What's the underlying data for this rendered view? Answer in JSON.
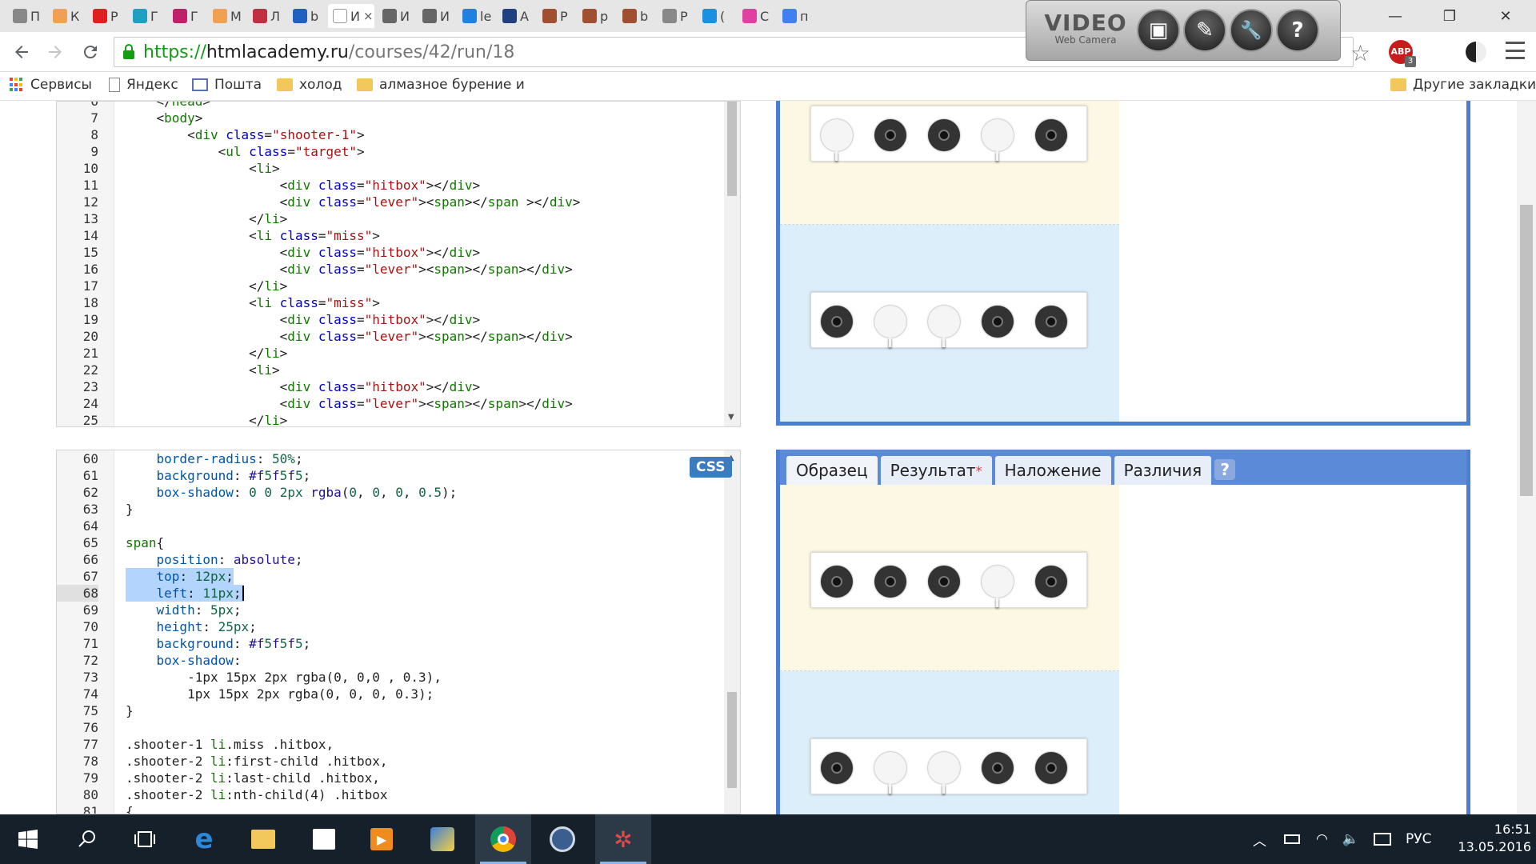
{
  "browser": {
    "tabs": [
      {
        "label": "П",
        "color": "#888888"
      },
      {
        "label": "К",
        "color": "#f0a050"
      },
      {
        "label": "Р",
        "color": "#e02020"
      },
      {
        "label": "Г",
        "color": "#20a0c0"
      },
      {
        "label": "Г",
        "color": "#c0206a"
      },
      {
        "label": "М",
        "color": "#f0a050"
      },
      {
        "label": "Л",
        "color": "#c03040"
      },
      {
        "label": "b",
        "color": "#2060c0"
      },
      {
        "label": "И",
        "color": "#ffffff",
        "active": true,
        "close": "×"
      },
      {
        "label": "И",
        "color": "#666666"
      },
      {
        "label": "И",
        "color": "#666666"
      },
      {
        "label": "le",
        "color": "#2080e0"
      },
      {
        "label": "А",
        "color": "#204080"
      },
      {
        "label": "Р",
        "color": "#a05030"
      },
      {
        "label": "р",
        "color": "#a05030"
      },
      {
        "label": "b",
        "color": "#a05030"
      },
      {
        "label": "Р",
        "color": "#888888"
      },
      {
        "label": "(",
        "color": "#1a90e0"
      },
      {
        "label": "С",
        "color": "#e040a0"
      },
      {
        "label": "п",
        "color": "#4080f0"
      }
    ],
    "url": {
      "scheme": "https://",
      "host": "htmlacademy.ru",
      "path": "/courses/42/run/18"
    },
    "bookmarks": [
      "Сервисы",
      "Яндекс",
      "Пошта",
      "холод",
      "алмазное бурение и",
      "Другие закладки"
    ],
    "abp_count": "3",
    "window_controls": {
      "minimize": "—",
      "restore": "❐",
      "close": "✕"
    }
  },
  "videocam": {
    "title": "VIDEO",
    "subtitle": "Web Camera",
    "buttons": [
      "▣",
      "✎",
      "🔧",
      "?"
    ]
  },
  "html_editor": {
    "lines": [
      {
        "n": "6",
        "t": "    </head>"
      },
      {
        "n": "7",
        "t": "    <body>"
      },
      {
        "n": "8",
        "t": "        <div class=\"shooter-1\">"
      },
      {
        "n": "9",
        "t": "            <ul class=\"target\">"
      },
      {
        "n": "10",
        "t": "                <li>"
      },
      {
        "n": "11",
        "t": "                    <div class=\"hitbox\"></div>"
      },
      {
        "n": "12",
        "t": "                    <div class=\"lever\"><span></span ></div>"
      },
      {
        "n": "13",
        "t": "                </li>"
      },
      {
        "n": "14",
        "t": "                <li class=\"miss\">"
      },
      {
        "n": "15",
        "t": "                    <div class=\"hitbox\"></div>"
      },
      {
        "n": "16",
        "t": "                    <div class=\"lever\"><span></span></div>"
      },
      {
        "n": "17",
        "t": "                </li>"
      },
      {
        "n": "18",
        "t": "                <li class=\"miss\">"
      },
      {
        "n": "19",
        "t": "                    <div class=\"hitbox\"></div>"
      },
      {
        "n": "20",
        "t": "                    <div class=\"lever\"><span></span></div>"
      },
      {
        "n": "21",
        "t": "                </li>"
      },
      {
        "n": "22",
        "t": "                <li>"
      },
      {
        "n": "23",
        "t": "                    <div class=\"hitbox\"></div>"
      },
      {
        "n": "24",
        "t": "                    <div class=\"lever\"><span></span></div>"
      },
      {
        "n": "25",
        "t": "                </li>"
      }
    ]
  },
  "css_editor": {
    "badge": "CSS",
    "lines": [
      {
        "n": "60",
        "t": "    border-radius: 50%;"
      },
      {
        "n": "61",
        "t": "    background: #f5f5f5;"
      },
      {
        "n": "62",
        "t": "    box-shadow: 0 0 2px rgba(0, 0, 0, 0.5);"
      },
      {
        "n": "63",
        "t": "}"
      },
      {
        "n": "64",
        "t": ""
      },
      {
        "n": "65",
        "t": "span{"
      },
      {
        "n": "66",
        "t": "    position: absolute;"
      },
      {
        "n": "67",
        "t": "    top: 12px;",
        "sel": true
      },
      {
        "n": "68",
        "t": "    left: 11px;",
        "sel": true,
        "cur": true
      },
      {
        "n": "69",
        "t": "    width: 5px;"
      },
      {
        "n": "70",
        "t": "    height: 25px;"
      },
      {
        "n": "71",
        "t": "    background: #f5f5f5;"
      },
      {
        "n": "72",
        "t": "    box-shadow:"
      },
      {
        "n": "73",
        "t": "        -1px 15px 2px rgba(0, 0,0 , 0.3),"
      },
      {
        "n": "74",
        "t": "        1px 15px 2px rgba(0, 0, 0, 0.3);"
      },
      {
        "n": "75",
        "t": "}"
      },
      {
        "n": "76",
        "t": ""
      },
      {
        "n": "77",
        "t": ".shooter-1 li.miss .hitbox,"
      },
      {
        "n": "78",
        "t": ".shooter-2 li:first-child .hitbox,"
      },
      {
        "n": "79",
        "t": ".shooter-2 li:last-child .hitbox,"
      },
      {
        "n": "80",
        "t": ".shooter-2 li:nth-child(4) .hitbox"
      },
      {
        "n": "81",
        "t": "{"
      }
    ]
  },
  "preview": {
    "tabs": [
      "Образец",
      "Результат",
      "Наложение",
      "Различия",
      "?"
    ],
    "result_marker": "*",
    "shooter_1": [
      "hit",
      "hit",
      "hit",
      "miss",
      "hit"
    ],
    "shooter_1_result": [
      "miss",
      "hit",
      "hit",
      "miss",
      "hit"
    ],
    "shooter_2": [
      "hit",
      "miss",
      "miss",
      "hit",
      "hit"
    ]
  },
  "taskbar": {
    "language": "РУС",
    "time": "16:51",
    "date": "13.05.2016"
  }
}
